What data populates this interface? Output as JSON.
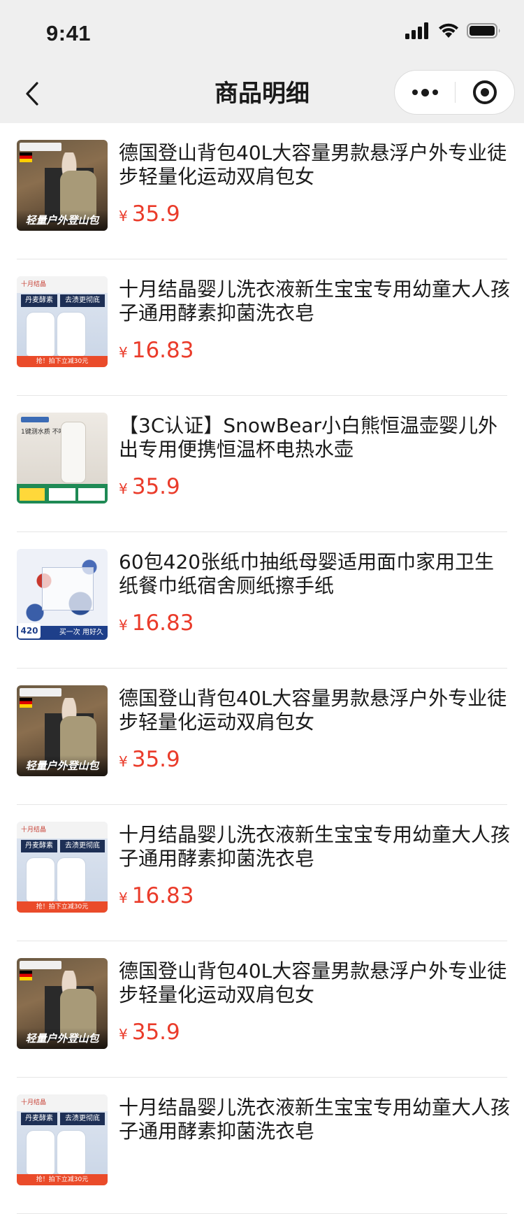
{
  "status_bar": {
    "time": "9:41"
  },
  "nav": {
    "title": "商品明细"
  },
  "currency_symbol": "¥",
  "thumb_text": {
    "backpack_caption": "轻量户外登山包",
    "detergent_brand": "十月结晶",
    "detergent_tag1": "丹麦酵素",
    "detergent_tag2": "去渍更彻底",
    "detergent_promo": "抢！拍下立减30元",
    "kettle_text": "1键测水质 不喝\"胶水\"",
    "tissue_count": "420",
    "tissue_slogan": "买一次 用好久"
  },
  "products": [
    {
      "title": "德国登山背包40L大容量男款悬浮户外专业徒步轻量化运动双肩包女",
      "price": "35.9",
      "thumb": "backpack"
    },
    {
      "title": "十月结晶婴儿洗衣液新生宝宝专用幼童大人孩子通用酵素抑菌洗衣皂",
      "price": "16.83",
      "thumb": "detergent"
    },
    {
      "title": "【3C认证】SnowBear小白熊恒温壶婴儿外出专用便携恒温杯电热水壶",
      "price": "35.9",
      "thumb": "kettle"
    },
    {
      "title": "60包420张纸巾抽纸母婴适用面巾家用卫生纸餐巾纸宿舍厕纸擦手纸",
      "price": "16.83",
      "thumb": "tissue"
    },
    {
      "title": "德国登山背包40L大容量男款悬浮户外专业徒步轻量化运动双肩包女",
      "price": "35.9",
      "thumb": "backpack"
    },
    {
      "title": "十月结晶婴儿洗衣液新生宝宝专用幼童大人孩子通用酵素抑菌洗衣皂",
      "price": "16.83",
      "thumb": "detergent"
    },
    {
      "title": "德国登山背包40L大容量男款悬浮户外专业徒步轻量化运动双肩包女",
      "price": "35.9",
      "thumb": "backpack"
    },
    {
      "title": "十月结晶婴儿洗衣液新生宝宝专用幼童大人孩子通用酵素抑菌洗衣皂",
      "price": "",
      "thumb": "detergent"
    }
  ],
  "colors": {
    "price": "#ea3b2a",
    "header_bg": "#efefef"
  }
}
